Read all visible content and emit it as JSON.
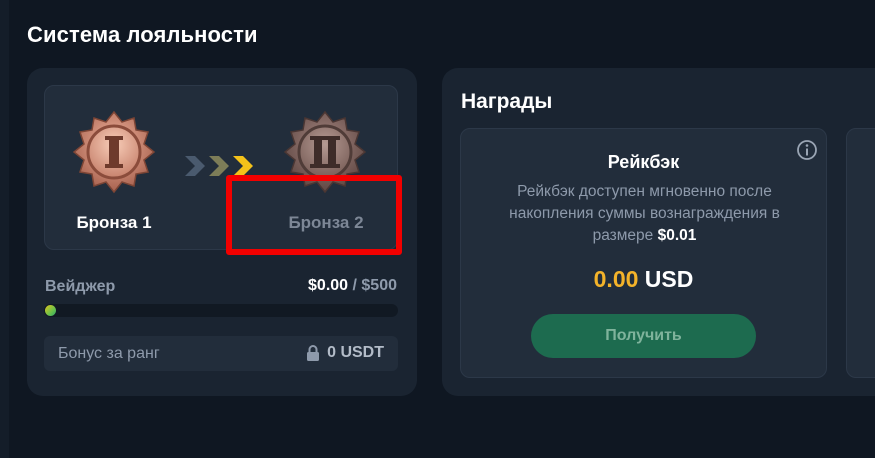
{
  "page": {
    "title": "Система лояльности"
  },
  "loyalty": {
    "current_rank": {
      "label": "Бронза 1",
      "numeral": "I",
      "badge_color": "#c7826d"
    },
    "next_rank": {
      "label": "Бронза 2",
      "numeral": "II",
      "badge_color": "#8f6b64"
    },
    "wager": {
      "label": "Вейджер",
      "current": "$0.00",
      "separator": " / ",
      "target": "$500",
      "progress_fraction": 0.0
    },
    "rank_bonus": {
      "label": "Бонус за ранг",
      "value": "0 USDT",
      "icon": "lock-icon"
    }
  },
  "rewards": {
    "title": "Награды",
    "cashback": {
      "title": "Рейкбэк",
      "description": "Рейкбэк доступен мгновенно после накопления суммы вознаграждения в размере",
      "min_amount": "$0.01",
      "amount": "0.00",
      "currency": "USD",
      "button_label": "Получить",
      "info_icon": "info-icon"
    }
  },
  "colors": {
    "background": "#0f1722",
    "card": "#1a2431",
    "accent_amount": "#f4b32a",
    "button": "#1d6b4f",
    "highlight": "#f20000"
  }
}
